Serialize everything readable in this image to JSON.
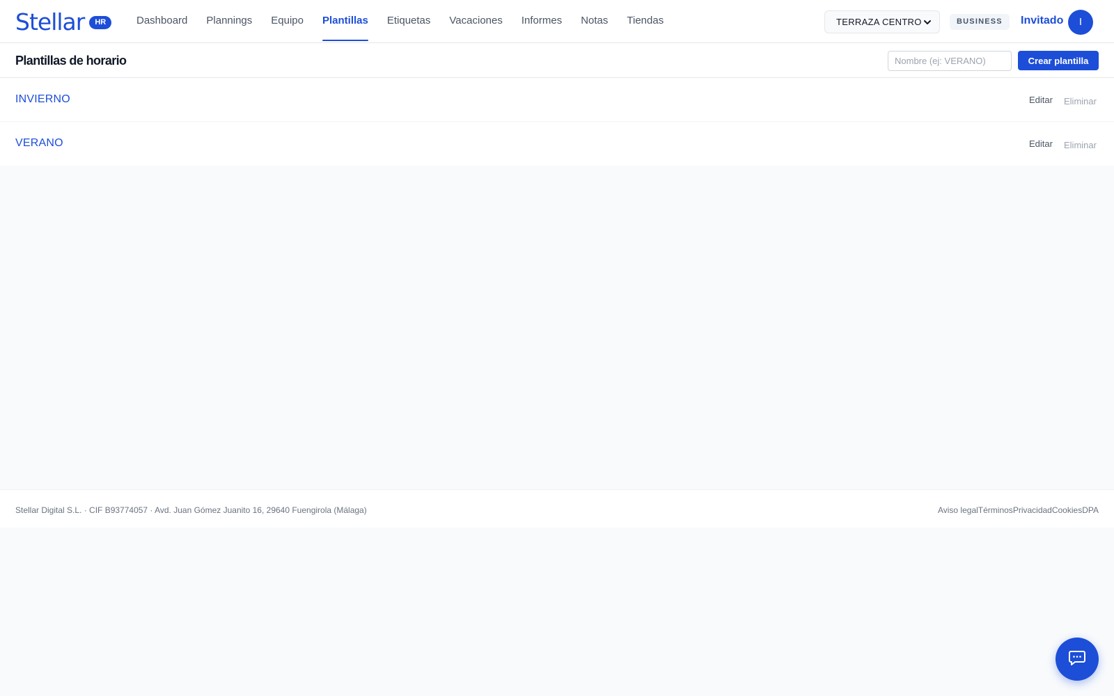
{
  "brand": {
    "name": "Stellar",
    "badge": "HR"
  },
  "nav": {
    "items": [
      {
        "label": "Dashboard",
        "active": false
      },
      {
        "label": "Plannings",
        "active": false
      },
      {
        "label": "Equipo",
        "active": false
      },
      {
        "label": "Plantillas",
        "active": true
      },
      {
        "label": "Etiquetas",
        "active": false
      },
      {
        "label": "Vacaciones",
        "active": false
      },
      {
        "label": "Informes",
        "active": false
      },
      {
        "label": "Notas",
        "active": false
      },
      {
        "label": "Tiendas",
        "active": false
      }
    ]
  },
  "header": {
    "store_select_value": "TERRAZA CENTRO",
    "plan_badge": "BUSINESS",
    "user_name": "Invitado",
    "avatar_initial": "I"
  },
  "page": {
    "title": "Plantillas de horario",
    "name_input_placeholder": "Nombre (ej: VERANO)",
    "name_input_value": "",
    "create_label": "Crear plantilla"
  },
  "templates": [
    {
      "name": "INVIERNO",
      "edit_label": "Editar",
      "delete_label": "Eliminar"
    },
    {
      "name": "VERANO",
      "edit_label": "Editar",
      "delete_label": "Eliminar"
    }
  ],
  "footer": {
    "company": "Stellar Digital S.L. · CIF B93774057 · Avd. Juan Gómez Juanito 16, 29640 Fuengirola (Málaga)",
    "links": [
      "Aviso legal",
      "Términos",
      "Privacidad",
      "Cookies",
      "DPA"
    ]
  },
  "icons": {
    "store_select": "chevron-down-icon",
    "chat": "chat-bubble-icon"
  },
  "colors": {
    "accent": "#1d4ed8",
    "background": "#f8fafc"
  }
}
